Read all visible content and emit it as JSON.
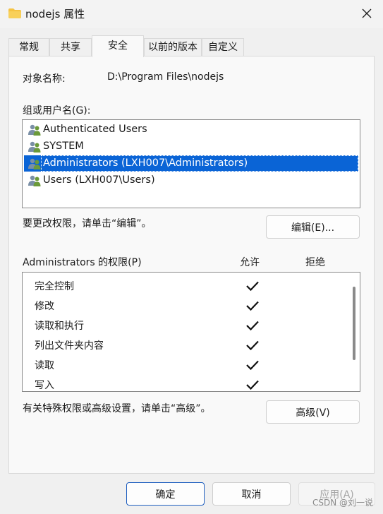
{
  "window": {
    "title": "nodejs 属性",
    "folder_color": "#f5c342"
  },
  "tabs": [
    {
      "label": "常规",
      "active": false
    },
    {
      "label": "共享",
      "active": false
    },
    {
      "label": "安全",
      "active": true
    },
    {
      "label": "以前的版本",
      "active": false
    },
    {
      "label": "自定义",
      "active": false
    }
  ],
  "object": {
    "label": "对象名称:",
    "value": "D:\\Program Files\\nodejs"
  },
  "groups": {
    "label": "组或用户名(G):",
    "items": [
      {
        "name": "Authenticated Users",
        "icon": "users-group-icon",
        "selected": false
      },
      {
        "name": "SYSTEM",
        "icon": "users-group-icon",
        "selected": false
      },
      {
        "name": "Administrators (LXH007\\Administrators)",
        "icon": "users-group-icon",
        "selected": true
      },
      {
        "name": "Users (LXH007\\Users)",
        "icon": "users-group-icon",
        "selected": false
      }
    ]
  },
  "edit_hint": "要更改权限，请单击“编辑”。",
  "edit_button": "编辑(E)...",
  "permissions": {
    "title": "Administrators 的权限(P)",
    "allow_header": "允许",
    "deny_header": "拒绝",
    "items": [
      {
        "name": "完全控制",
        "allow": true,
        "deny": false
      },
      {
        "name": "修改",
        "allow": true,
        "deny": false
      },
      {
        "name": "读取和执行",
        "allow": true,
        "deny": false
      },
      {
        "name": "列出文件夹内容",
        "allow": true,
        "deny": false
      },
      {
        "name": "读取",
        "allow": true,
        "deny": false
      },
      {
        "name": "写入",
        "allow": true,
        "deny": false
      }
    ]
  },
  "advanced_hint": "有关特殊权限或高级设置，请单击“高级”。",
  "advanced_button": "高级(V)",
  "footer": {
    "ok": "确定",
    "cancel": "取消",
    "apply": "应用(A)"
  },
  "watermark": "CSDN @刘一说",
  "colors": {
    "accent": "#0a64d6",
    "primary_border": "#1f5fbf"
  }
}
